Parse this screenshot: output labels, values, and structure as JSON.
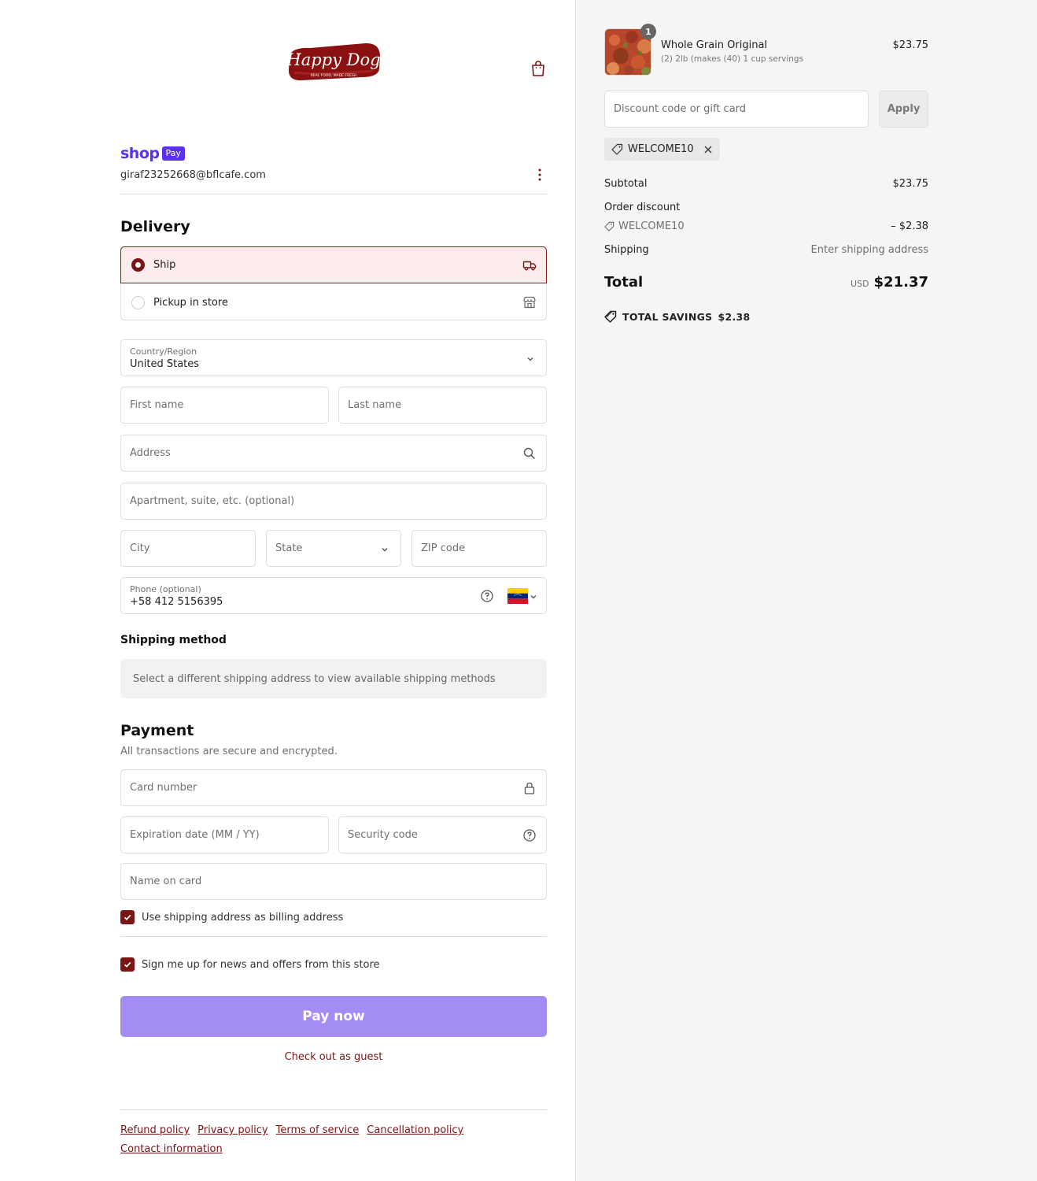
{
  "brand": {
    "logo_text": "Happy Dog",
    "logo_tagline": "REAL FOOD, MADE FRESH"
  },
  "account": {
    "shop_word": "shop",
    "pay_badge": "Pay",
    "email": "giraf23252668@bflcafe.com"
  },
  "delivery": {
    "title": "Delivery",
    "options": [
      {
        "label": "Ship",
        "selected": true,
        "icon": "truck-icon"
      },
      {
        "label": "Pickup in store",
        "selected": false,
        "icon": "store-icon"
      }
    ]
  },
  "address_form": {
    "country_label": "Country/Region",
    "country_value": "United States",
    "first_name_placeholder": "First name",
    "last_name_placeholder": "Last name",
    "address_placeholder": "Address",
    "apartment_placeholder": "Apartment, suite, etc. (optional)",
    "city_placeholder": "City",
    "state_placeholder": "State",
    "zip_placeholder": "ZIP code",
    "phone_label": "Phone (optional)",
    "phone_value": "+58 412 5156395",
    "phone_country_flag": "venezuela-flag"
  },
  "shipping_method": {
    "title": "Shipping method",
    "note": "Select a different shipping address to view available shipping methods"
  },
  "payment": {
    "title": "Payment",
    "subtitle": "All transactions are secure and encrypted.",
    "card_number_placeholder": "Card number",
    "expiry_placeholder": "Expiration date (MM / YY)",
    "security_placeholder": "Security code",
    "name_placeholder": "Name on card",
    "billing_same_label": "Use shipping address as billing address",
    "billing_same_checked": true,
    "newsletter_label": "Sign me up for news and offers from this store",
    "newsletter_checked": true,
    "pay_button": "Pay now",
    "guest_link": "Check out as guest"
  },
  "footer": {
    "links": [
      "Refund policy",
      "Privacy policy",
      "Terms of service",
      "Cancellation policy",
      "Contact information"
    ]
  },
  "order": {
    "product": {
      "name": "Whole Grain Original",
      "variant": "(2) 2lb (makes (40) 1 cup servings",
      "price": "$23.75",
      "quantity": "1"
    },
    "discount_placeholder": "Discount code or gift card",
    "apply_label": "Apply",
    "applied_code": "WELCOME10",
    "subtotal_label": "Subtotal",
    "subtotal_value": "$23.75",
    "order_discount_label": "Order discount",
    "order_discount_code": "WELCOME10",
    "order_discount_value": "– $2.38",
    "shipping_label": "Shipping",
    "shipping_value": "Enter shipping address",
    "total_label": "Total",
    "total_currency": "USD",
    "total_value": "$21.37",
    "savings_label": "TOTAL SAVINGS",
    "savings_value": "$2.38"
  },
  "colors": {
    "accent": "#7a1414",
    "shop_purple": "#5a31f4",
    "pay_button": "#a48cf5"
  }
}
